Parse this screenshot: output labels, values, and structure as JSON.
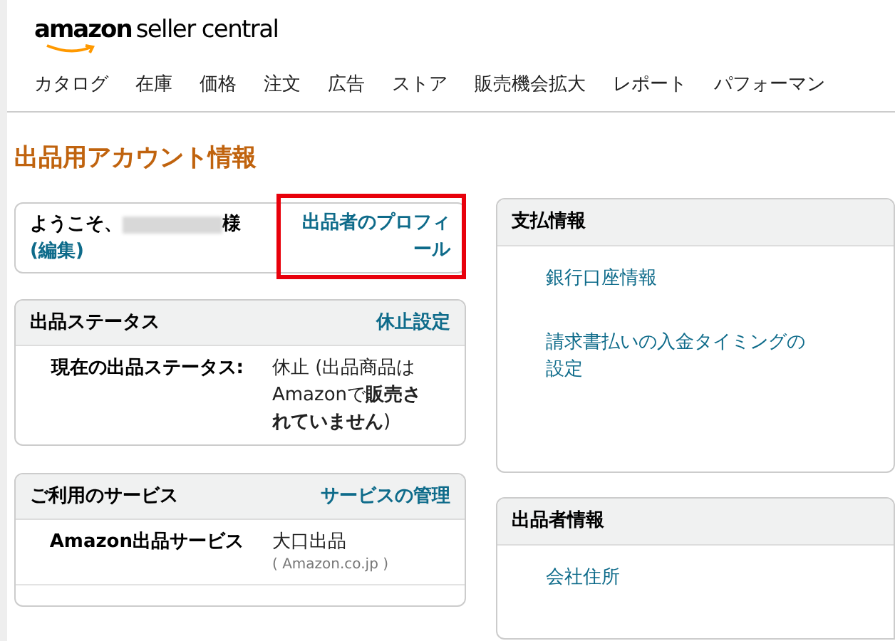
{
  "logo": {
    "brand": "amazon",
    "product": "seller central"
  },
  "nav": [
    {
      "label": "カタログ"
    },
    {
      "label": "在庫"
    },
    {
      "label": "価格"
    },
    {
      "label": "注文"
    },
    {
      "label": "広告"
    },
    {
      "label": "ストア"
    },
    {
      "label": "販売機会拡大"
    },
    {
      "label": "レポート"
    },
    {
      "label": "パフォーマン"
    }
  ],
  "page_title": "出品用アカウント情報",
  "welcome": {
    "greeting": "ようこそ、",
    "suffix": "様",
    "edit_link": "(編集)",
    "profile_link": "出品者のプロフィール",
    "highlighted": true
  },
  "listing_status": {
    "title": "出品ステータス",
    "action": "休止設定",
    "rows": [
      {
        "label": "現在の出品ステータス:",
        "value": "休止 (出品商品はAmazonで**販売されていません**)"
      }
    ]
  },
  "services": {
    "title": "ご利用のサービス",
    "action": "サービスの管理",
    "rows": [
      {
        "label": "Amazon出品サービス",
        "value": "大口出品",
        "note": "( Amazon.co.jp )"
      }
    ]
  },
  "payment_info": {
    "title": "支払情報",
    "links": [
      "銀行口座情報",
      "請求書払いの入金タイミングの設定"
    ]
  },
  "seller_info": {
    "title": "出品者情報",
    "links": [
      "会社住所"
    ]
  }
}
